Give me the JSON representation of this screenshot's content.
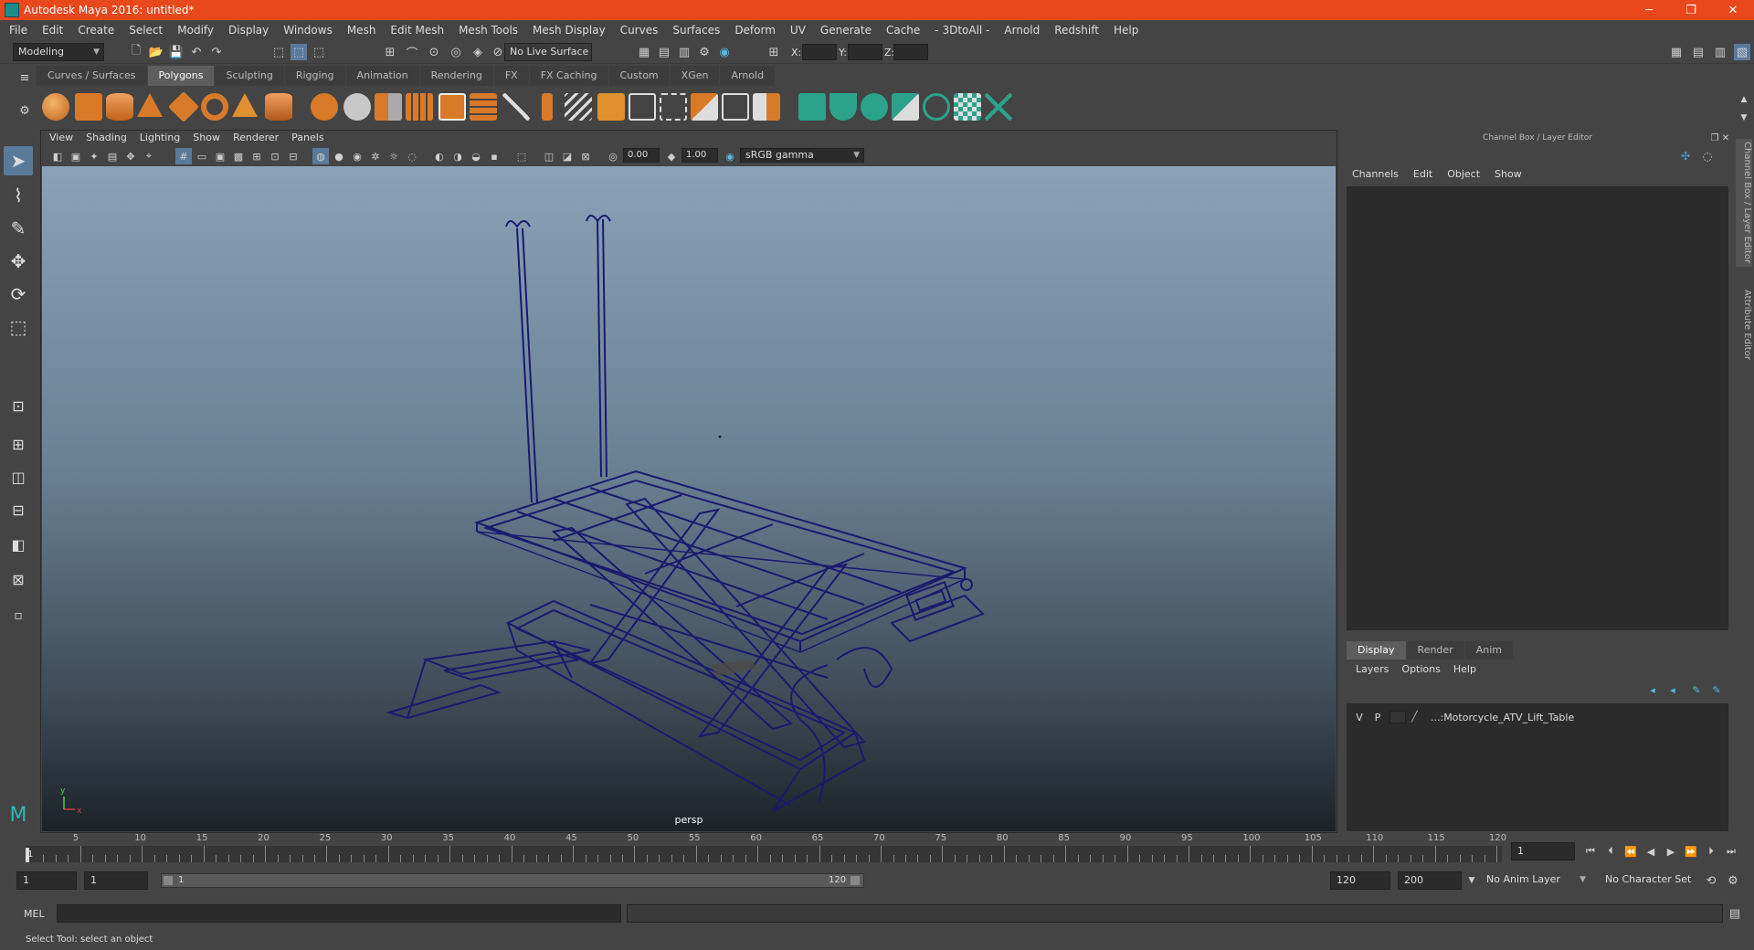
{
  "window": {
    "title": "Autodesk Maya 2016: untitled*",
    "minimize": "─",
    "maximize": "❐",
    "close": "✕"
  },
  "menubar": [
    "File",
    "Edit",
    "Create",
    "Select",
    "Modify",
    "Display",
    "Windows",
    "Mesh",
    "Edit Mesh",
    "Mesh Tools",
    "Mesh Display",
    "Curves",
    "Surfaces",
    "Deform",
    "UV",
    "Generate",
    "Cache",
    "- 3DtoAll -",
    "Arnold",
    "Redshift",
    "Help"
  ],
  "statusline": {
    "mode": "Modeling",
    "live_surface": "No Live Surface",
    "x_label": "X:",
    "y_label": "Y:",
    "z_label": "Z:"
  },
  "shelf_tabs": [
    "Curves / Surfaces",
    "Polygons",
    "Sculpting",
    "Rigging",
    "Animation",
    "Rendering",
    "FX",
    "FX Caching",
    "Custom",
    "XGen",
    "Arnold"
  ],
  "shelf_active_tab": "Polygons",
  "viewport": {
    "menu": [
      "View",
      "Shading",
      "Lighting",
      "Show",
      "Renderer",
      "Panels"
    ],
    "exposure": "0.00",
    "gamma": "1.00",
    "color_space": "sRGB gamma",
    "camera_label": "persp",
    "axis_y": "y",
    "axis_x": "x"
  },
  "channel_box": {
    "title": "Channel Box / Layer Editor",
    "menu": [
      "Channels",
      "Edit",
      "Object",
      "Show"
    ],
    "layer_tabs": [
      "Display",
      "Render",
      "Anim"
    ],
    "layer_active_tab": "Display",
    "layer_menu": [
      "Layers",
      "Options",
      "Help"
    ],
    "layer": {
      "v": "V",
      "p": "P",
      "name": "...:Motorcycle_ATV_Lift_Table"
    }
  },
  "side_tabs": [
    "Channel Box / Layer Editor",
    "Attribute Editor"
  ],
  "timeline": {
    "start": 1,
    "end": 120,
    "labels": [
      "5",
      "10",
      "15",
      "20",
      "25",
      "30",
      "35",
      "40",
      "45",
      "50",
      "55",
      "60",
      "65",
      "70",
      "75",
      "80",
      "85",
      "90",
      "95",
      "100",
      "105",
      "110",
      "115",
      "120"
    ],
    "current_frame_label": "1",
    "current_frame_field": "1"
  },
  "range": {
    "start_field": "1",
    "start_inner": "1",
    "slider_start": "1",
    "slider_end": "120",
    "end_inner": "120",
    "end_field": "200",
    "anim_layer": "No Anim Layer",
    "character_set": "No Character Set"
  },
  "command_line": {
    "label": "MEL"
  },
  "help_line": {
    "text": "Select Tool: select an object"
  },
  "colors": {
    "title_bar": "#e8481c",
    "wireframe": "#1a1a6e",
    "shelf_orange": "#e0852a",
    "shelf_teal": "#2aa38a"
  }
}
